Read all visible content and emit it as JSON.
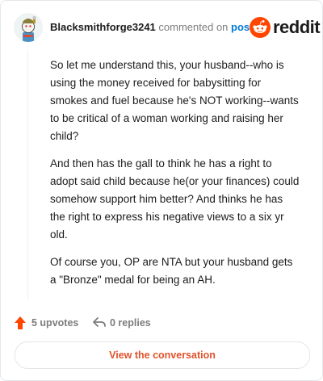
{
  "header": {
    "username": "Blacksmithforge3241",
    "action_text": "commented on",
    "post_link": "post",
    "brand": "reddit"
  },
  "comment": {
    "paragraphs": [
      "So let me understand this, your husband--who is using the money received for babysitting for smokes and fuel because he's NOT working--wants to be critical of a woman working and raising her child?",
      "And then has the gall to think he has a right to adopt said child because he(or your finances) could somehow support him better? And thinks he has the right to express his negative views to a six yr old.",
      "Of course you, OP are NTA but your husband gets a \"Bronze\" medal for being an AH."
    ]
  },
  "actions": {
    "upvotes": "5 upvotes",
    "replies": "0 replies"
  },
  "cta": {
    "label": "View the conversation"
  },
  "colors": {
    "brand_orange": "#ff4500",
    "link_blue": "#0079d3",
    "cta_text": "#e0522b"
  }
}
